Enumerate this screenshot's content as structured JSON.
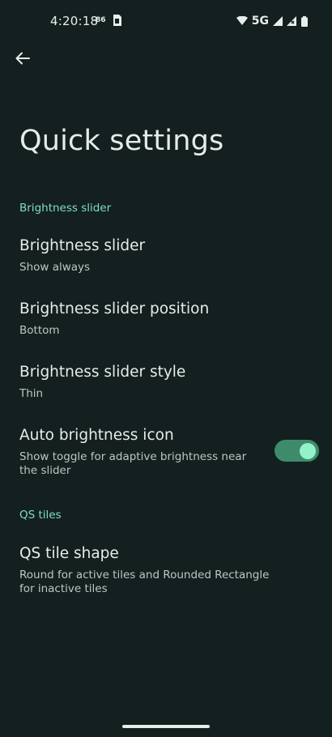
{
  "status_bar": {
    "time": "4:20:18",
    "small_indicator": "86",
    "network": "5G",
    "icons": [
      "sim-card-icon",
      "wifi-icon",
      "signal-icon",
      "signal-no-data-icon",
      "battery-icon"
    ]
  },
  "toolbar": {
    "back_icon": "arrow-left-icon"
  },
  "page": {
    "title": "Quick settings"
  },
  "sections": {
    "brightness": {
      "header": "Brightness slider",
      "items": [
        {
          "title": "Brightness slider",
          "summary": "Show always"
        },
        {
          "title": "Brightness slider position",
          "summary": "Bottom"
        },
        {
          "title": "Brightness slider style",
          "summary": "Thin"
        },
        {
          "title": "Auto brightness icon",
          "summary": "Show toggle for adaptive brightness near the slider",
          "toggle_on": true
        }
      ]
    },
    "qs_tiles": {
      "header": "QS tiles",
      "items": [
        {
          "title": "QS tile shape",
          "summary": "Round for active tiles and Rounded Rectangle for inactive tiles"
        }
      ]
    }
  },
  "colors": {
    "background": "#13201f",
    "accent": "#7fdcc3",
    "toggle_track": "#3e8b6b",
    "toggle_thumb": "#93f2ca"
  }
}
